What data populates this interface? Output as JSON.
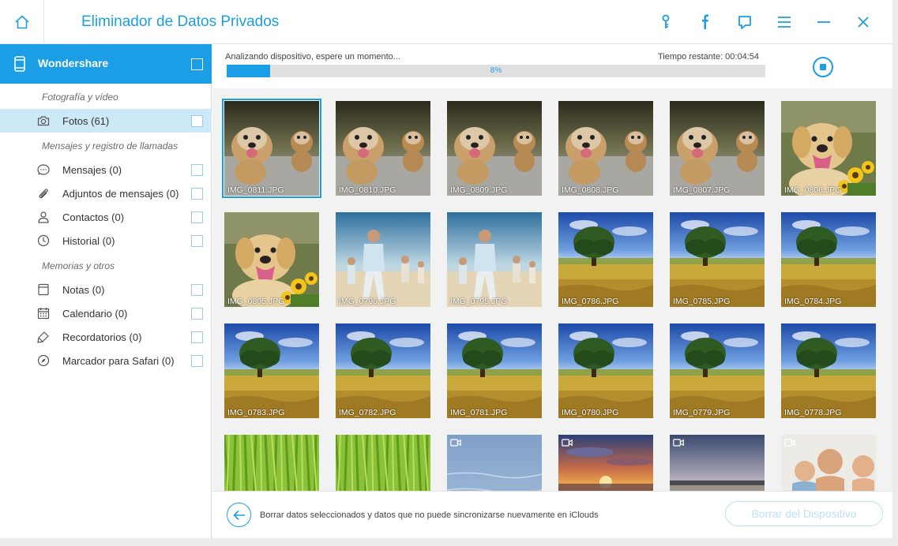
{
  "app": {
    "title": "Eliminador de Datos Privados"
  },
  "titlebar": {
    "icons": [
      "key-icon",
      "facebook-icon",
      "feedback-icon",
      "menu-icon",
      "minimize-icon",
      "close-icon"
    ]
  },
  "device": {
    "name": "Wondershare"
  },
  "sidebar": {
    "sections": [
      {
        "title": "Fotografía y vídeo"
      },
      {
        "title": "Mensajes y registro de llamadas"
      },
      {
        "title": "Memorias y otros"
      }
    ],
    "items": [
      {
        "label": "Fotos (61)",
        "icon": "camera-icon"
      },
      {
        "label": "Mensajes (0)",
        "icon": "message-icon"
      },
      {
        "label": "Adjuntos de mensajes (0)",
        "icon": "paperclip-icon"
      },
      {
        "label": "Contactos (0)",
        "icon": "contact-icon"
      },
      {
        "label": "Historial (0)",
        "icon": "history-icon"
      },
      {
        "label": "Notas (0)",
        "icon": "notes-icon"
      },
      {
        "label": "Calendario (0)",
        "icon": "calendar-icon"
      },
      {
        "label": "Recordatorios (0)",
        "icon": "reminder-icon"
      },
      {
        "label": "Marcador para Safari (0)",
        "icon": "compass-icon"
      }
    ]
  },
  "scan": {
    "status": "Analizando dispositivo, espere un momento...",
    "time_remaining": "Tiempo restante: 00:04:54",
    "percent_label": "8%",
    "progress": 0.08
  },
  "photos": [
    {
      "name": "IMG_0811.JPG",
      "scene": "puppies",
      "selected": true
    },
    {
      "name": "IMG_0810.JPG",
      "scene": "puppies"
    },
    {
      "name": "IMG_0809.JPG",
      "scene": "puppies"
    },
    {
      "name": "IMG_0808.JPG",
      "scene": "puppies"
    },
    {
      "name": "IMG_0807.JPG",
      "scene": "puppies"
    },
    {
      "name": "IMG_0806.JPG",
      "scene": "dog"
    },
    {
      "name": "IMG_0805.JPG",
      "scene": "dog"
    },
    {
      "name": "IMG_0796.JPG",
      "scene": "family"
    },
    {
      "name": "IMG_0795.JPG",
      "scene": "family"
    },
    {
      "name": "IMG_0786.JPG",
      "scene": "tree"
    },
    {
      "name": "IMG_0785.JPG",
      "scene": "tree"
    },
    {
      "name": "IMG_0784.JPG",
      "scene": "tree"
    },
    {
      "name": "IMG_0783.JPG",
      "scene": "tree"
    },
    {
      "name": "IMG_0782.JPG",
      "scene": "tree"
    },
    {
      "name": "IMG_0781.JPG",
      "scene": "tree"
    },
    {
      "name": "IMG_0780.JPG",
      "scene": "tree"
    },
    {
      "name": "IMG_0779.JPG",
      "scene": "tree"
    },
    {
      "name": "IMG_0778.JPG",
      "scene": "tree"
    },
    {
      "name": "",
      "scene": "grass"
    },
    {
      "name": "",
      "scene": "grass"
    },
    {
      "name": "",
      "scene": "water",
      "video": true
    },
    {
      "name": "",
      "scene": "sunset",
      "video": true
    },
    {
      "name": "",
      "scene": "beach",
      "video": true
    },
    {
      "name": "",
      "scene": "people",
      "video": true
    }
  ],
  "footer": {
    "text": "Borrar datos seleccionados y datos que no puede sincronizarse nuevamente en iClouds",
    "button": "Borrar del Dispositivo"
  },
  "colors": {
    "accent": "#1c9ee6",
    "selected_row": "#cde9f8",
    "disabled_button": "#bde1f5"
  }
}
